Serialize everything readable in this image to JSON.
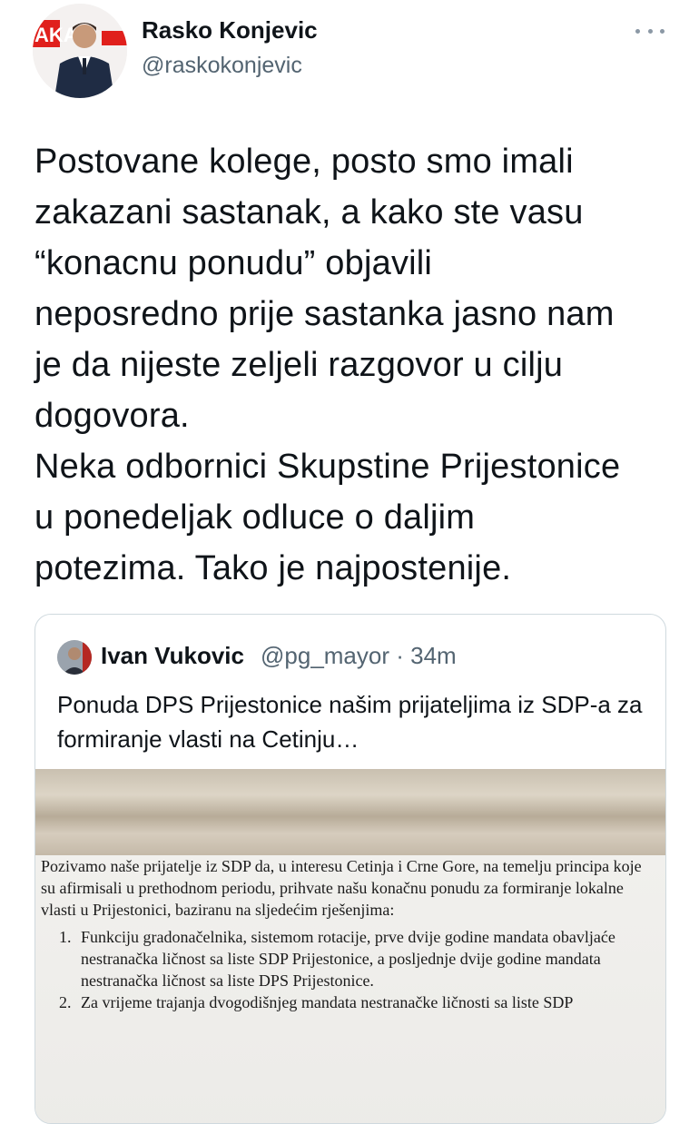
{
  "tweet": {
    "author_name": "Rasko Konjevic",
    "author_handle": "@raskokonjevic",
    "body": "Postovane kolege, posto smo imali\nzakazani sastanak, a kako ste vasu\n“konacnu ponudu” objavili\nneposredno prije sastanka jasno nam\nje da nijeste zeljeli razgovor u cilju\ndogovora.\nNeka odbornici Skupstine Prijestonice\nu ponedeljak odluce o daljim\npotezima. Tako je najpostenije.",
    "avatar_banner_text": "AKA"
  },
  "quote": {
    "author_name": "Ivan Vukovic",
    "meta": "@pg_mayor · 34m",
    "text": "Ponuda DPS Prijestonice našim prijateljima iz SDP-a za formiranje vlasti na Cetinju…"
  },
  "document": {
    "intro": "Pozivamo naše prijatelje iz SDP da, u interesu Cetinja i Crne Gore, na temelju principa koje su afirmisali u prethodnom periodu, prihvate našu konačnu ponudu za formiranje lokalne vlasti u Prijestonici, baziranu na sljedećim rješenjima:",
    "items": [
      {
        "num": "1.",
        "text": "Funkciju gradonačelnika, sistemom rotacije, prve dvije godine mandata obavljaće nestranačka ličnost sa liste SDP Prijestonice, a posljednje dvije godine mandata nestranačka ličnost sa liste DPS Prijestonice."
      },
      {
        "num": "2.",
        "text": "Za vrijeme trajanja dvogodišnjeg mandata nestranačke ličnosti sa liste SDP"
      }
    ]
  },
  "colors": {
    "text": "#0f1419",
    "secondary": "#536471",
    "border": "#cfd9de",
    "brand_red": "#e0201c"
  }
}
